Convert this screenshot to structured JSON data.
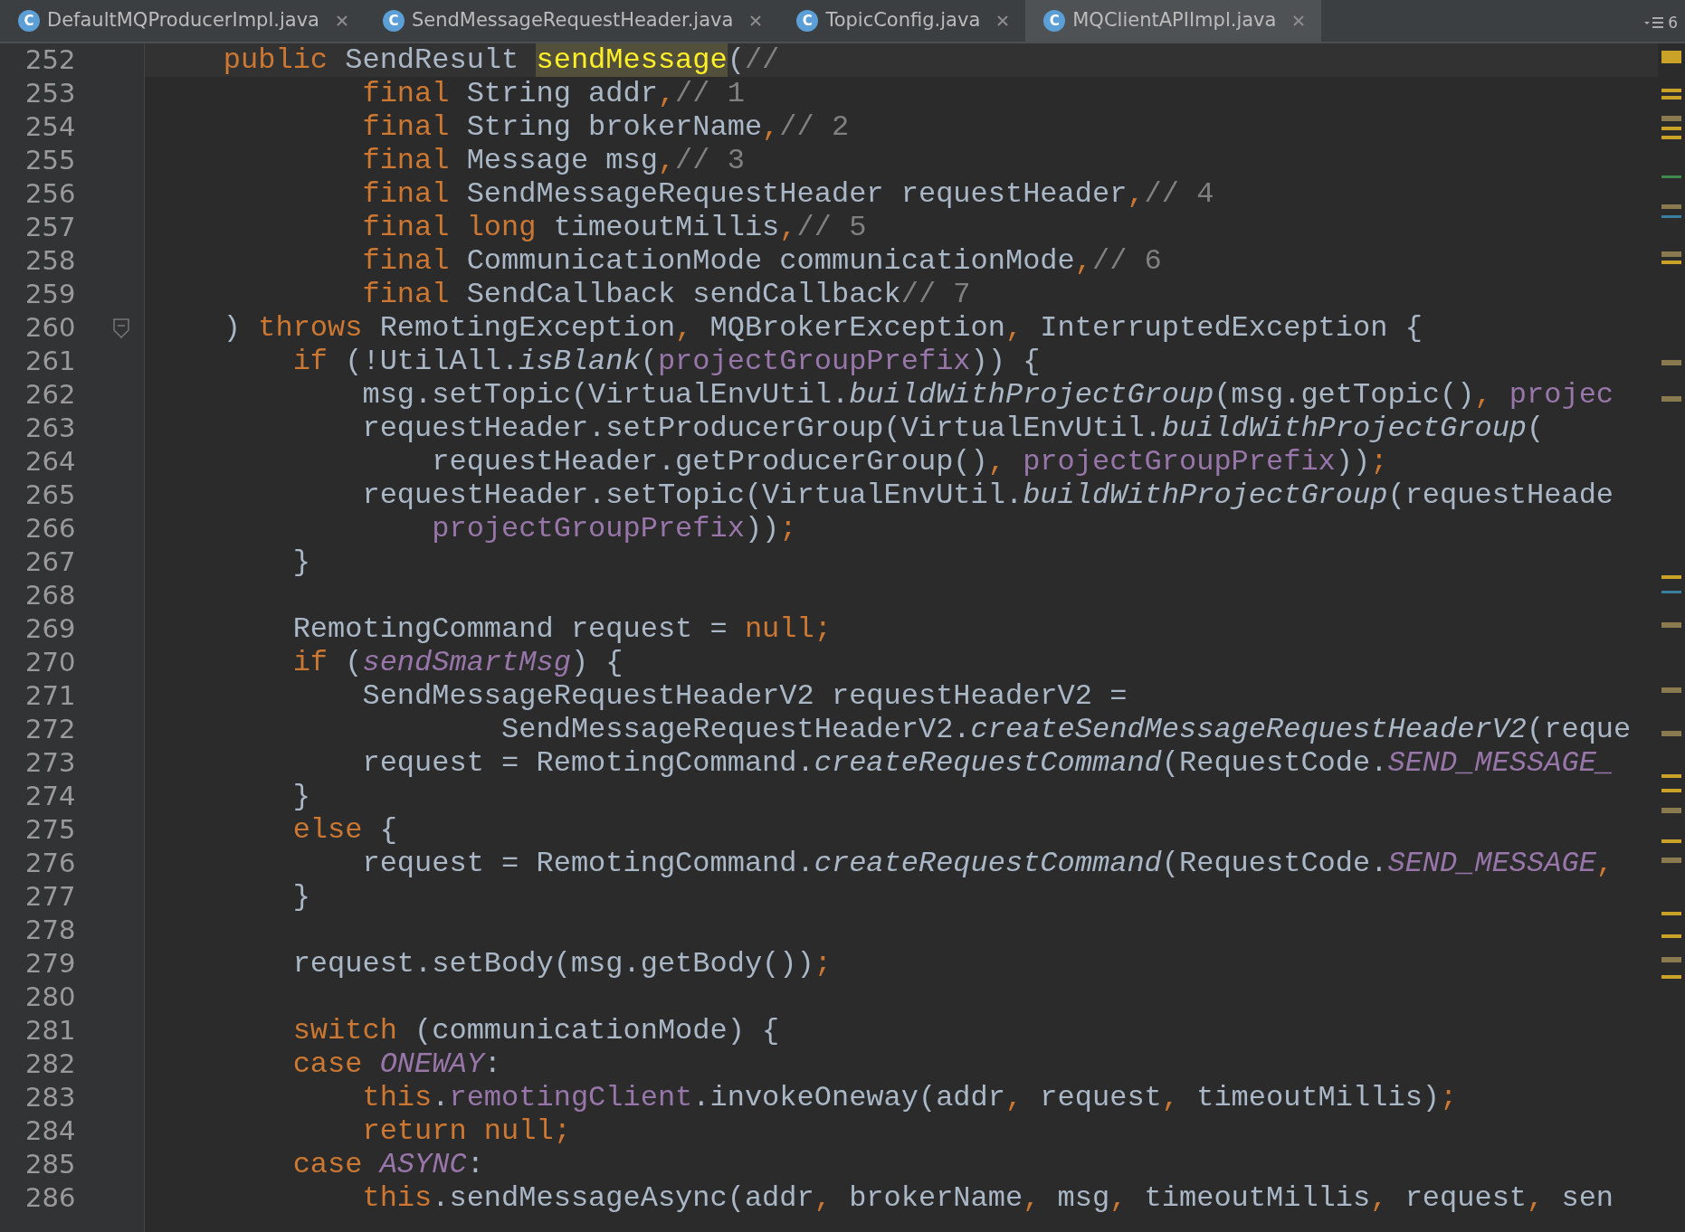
{
  "tabs": [
    {
      "badge": "C",
      "label": "DefaultMQProducerImpl.java",
      "selected": false
    },
    {
      "badge": "C",
      "label": "SendMessageRequestHeader.java",
      "selected": false
    },
    {
      "badge": "C",
      "label": "TopicConfig.java",
      "selected": false
    },
    {
      "badge": "C",
      "label": "MQClientAPIImpl.java",
      "selected": true
    }
  ],
  "tab_overflow_count": "6",
  "lines": [
    {
      "n": "252",
      "current": true,
      "tokens": [
        {
          "kind": "keyword",
          "t": "    public "
        },
        {
          "kind": "plain",
          "t": "SendResult "
        },
        {
          "kind": "highlight",
          "t": "sendMessage"
        },
        {
          "kind": "plain",
          "t": "("
        },
        {
          "kind": "comment",
          "t": "//"
        }
      ]
    },
    {
      "n": "253",
      "tokens": [
        {
          "kind": "keyword",
          "t": "            final "
        },
        {
          "kind": "plain",
          "t": "String addr"
        },
        {
          "kind": "keyword",
          "t": ","
        },
        {
          "kind": "comment",
          "t": "// 1"
        }
      ]
    },
    {
      "n": "254",
      "tokens": [
        {
          "kind": "keyword",
          "t": "            final "
        },
        {
          "kind": "plain",
          "t": "String brokerName"
        },
        {
          "kind": "keyword",
          "t": ","
        },
        {
          "kind": "comment",
          "t": "// 2"
        }
      ]
    },
    {
      "n": "255",
      "tokens": [
        {
          "kind": "keyword",
          "t": "            final "
        },
        {
          "kind": "plain",
          "t": "Message msg"
        },
        {
          "kind": "keyword",
          "t": ","
        },
        {
          "kind": "comment",
          "t": "// 3"
        }
      ]
    },
    {
      "n": "256",
      "tokens": [
        {
          "kind": "keyword",
          "t": "            final "
        },
        {
          "kind": "plain",
          "t": "SendMessageRequestHeader requestHeader"
        },
        {
          "kind": "keyword",
          "t": ","
        },
        {
          "kind": "comment",
          "t": "// 4"
        }
      ]
    },
    {
      "n": "257",
      "tokens": [
        {
          "kind": "keyword",
          "t": "            final long "
        },
        {
          "kind": "plain",
          "t": "timeoutMillis"
        },
        {
          "kind": "keyword",
          "t": ","
        },
        {
          "kind": "comment",
          "t": "// 5"
        }
      ]
    },
    {
      "n": "258",
      "tokens": [
        {
          "kind": "keyword",
          "t": "            final "
        },
        {
          "kind": "plain",
          "t": "CommunicationMode communicationMode"
        },
        {
          "kind": "keyword",
          "t": ","
        },
        {
          "kind": "comment",
          "t": "// 6"
        }
      ]
    },
    {
      "n": "259",
      "tokens": [
        {
          "kind": "keyword",
          "t": "            final "
        },
        {
          "kind": "plain",
          "t": "SendCallback sendCallback"
        },
        {
          "kind": "comment",
          "t": "// 7"
        }
      ]
    },
    {
      "n": "260",
      "fold_marker": true,
      "tokens": [
        {
          "kind": "plain",
          "t": "    ) "
        },
        {
          "kind": "keyword",
          "t": "throws "
        },
        {
          "kind": "plain",
          "t": "RemotingException"
        },
        {
          "kind": "keyword",
          "t": ", "
        },
        {
          "kind": "plain",
          "t": "MQBrokerException"
        },
        {
          "kind": "keyword",
          "t": ", "
        },
        {
          "kind": "plain",
          "t": "InterruptedException {"
        }
      ]
    },
    {
      "n": "261",
      "tokens": [
        {
          "kind": "keyword",
          "t": "        if "
        },
        {
          "kind": "plain",
          "t": "(!UtilAll."
        },
        {
          "kind": "italic",
          "t": "isBlank"
        },
        {
          "kind": "plain",
          "t": "("
        },
        {
          "kind": "field",
          "t": "projectGroupPrefix"
        },
        {
          "kind": "plain",
          "t": ")) {"
        }
      ]
    },
    {
      "n": "262",
      "tokens": [
        {
          "kind": "plain",
          "t": "            msg.setTopic(VirtualEnvUtil."
        },
        {
          "kind": "italic",
          "t": "buildWithProjectGroup"
        },
        {
          "kind": "plain",
          "t": "(msg.getTopic()"
        },
        {
          "kind": "keyword",
          "t": ", "
        },
        {
          "kind": "field",
          "t": "projec"
        }
      ]
    },
    {
      "n": "263",
      "tokens": [
        {
          "kind": "plain",
          "t": "            requestHeader.setProducerGroup(VirtualEnvUtil."
        },
        {
          "kind": "italic",
          "t": "buildWithProjectGroup"
        },
        {
          "kind": "plain",
          "t": "("
        }
      ]
    },
    {
      "n": "264",
      "tokens": [
        {
          "kind": "plain",
          "t": "                requestHeader.getProducerGroup()"
        },
        {
          "kind": "keyword",
          "t": ", "
        },
        {
          "kind": "field",
          "t": "projectGroupPrefix"
        },
        {
          "kind": "plain",
          "t": "))"
        },
        {
          "kind": "keyword",
          "t": ";"
        }
      ]
    },
    {
      "n": "265",
      "tokens": [
        {
          "kind": "plain",
          "t": "            requestHeader.setTopic(VirtualEnvUtil."
        },
        {
          "kind": "italic",
          "t": "buildWithProjectGroup"
        },
        {
          "kind": "plain",
          "t": "(requestHeade"
        }
      ]
    },
    {
      "n": "266",
      "tokens": [
        {
          "kind": "field",
          "t": "                projectGroupPrefix"
        },
        {
          "kind": "plain",
          "t": "))"
        },
        {
          "kind": "keyword",
          "t": ";"
        }
      ]
    },
    {
      "n": "267",
      "tokens": [
        {
          "kind": "plain",
          "t": "        }"
        }
      ]
    },
    {
      "n": "268"
    },
    {
      "n": "269",
      "tokens": [
        {
          "kind": "plain",
          "t": "        RemotingCommand request = "
        },
        {
          "kind": "keyword",
          "t": "null;"
        }
      ]
    },
    {
      "n": "270",
      "tokens": [
        {
          "kind": "keyword",
          "t": "        if "
        },
        {
          "kind": "plain",
          "t": "("
        },
        {
          "kind": "static",
          "t": "sendSmartMsg"
        },
        {
          "kind": "plain",
          "t": ") {"
        }
      ]
    },
    {
      "n": "271",
      "tokens": [
        {
          "kind": "plain",
          "t": "            SendMessageRequestHeaderV2 requestHeaderV2 ="
        }
      ]
    },
    {
      "n": "272",
      "tokens": [
        {
          "kind": "plain",
          "t": "                    SendMessageRequestHeaderV2."
        },
        {
          "kind": "italic",
          "t": "createSendMessageRequestHeaderV2"
        },
        {
          "kind": "plain",
          "t": "(reque"
        }
      ]
    },
    {
      "n": "273",
      "tokens": [
        {
          "kind": "plain",
          "t": "            request = RemotingCommand."
        },
        {
          "kind": "italic",
          "t": "createRequestCommand"
        },
        {
          "kind": "plain",
          "t": "(RequestCode."
        },
        {
          "kind": "static",
          "t": "SEND_MESSAGE_"
        }
      ]
    },
    {
      "n": "274",
      "tokens": [
        {
          "kind": "plain",
          "t": "        }"
        }
      ]
    },
    {
      "n": "275",
      "tokens": [
        {
          "kind": "keyword",
          "t": "        else "
        },
        {
          "kind": "plain",
          "t": "{"
        }
      ]
    },
    {
      "n": "276",
      "tokens": [
        {
          "kind": "plain",
          "t": "            request = RemotingCommand."
        },
        {
          "kind": "italic",
          "t": "createRequestCommand"
        },
        {
          "kind": "plain",
          "t": "(RequestCode."
        },
        {
          "kind": "static",
          "t": "SEND_MESSAGE"
        },
        {
          "kind": "keyword",
          "t": ","
        }
      ]
    },
    {
      "n": "277",
      "tokens": [
        {
          "kind": "plain",
          "t": "        }"
        }
      ]
    },
    {
      "n": "278"
    },
    {
      "n": "279",
      "tokens": [
        {
          "kind": "plain",
          "t": "        request.setBody(msg.getBody())"
        },
        {
          "kind": "keyword",
          "t": ";"
        }
      ]
    },
    {
      "n": "280"
    },
    {
      "n": "281",
      "tokens": [
        {
          "kind": "keyword",
          "t": "        switch "
        },
        {
          "kind": "plain",
          "t": "(communicationMode) {"
        }
      ]
    },
    {
      "n": "282",
      "tokens": [
        {
          "kind": "keyword",
          "t": "        case "
        },
        {
          "kind": "static",
          "t": "ONEWAY"
        },
        {
          "kind": "plain",
          "t": ":"
        }
      ]
    },
    {
      "n": "283",
      "tokens": [
        {
          "kind": "keyword",
          "t": "            this"
        },
        {
          "kind": "plain",
          "t": "."
        },
        {
          "kind": "field",
          "t": "remotingClient"
        },
        {
          "kind": "plain",
          "t": ".invokeOneway(addr"
        },
        {
          "kind": "keyword",
          "t": ", "
        },
        {
          "kind": "plain",
          "t": "request"
        },
        {
          "kind": "keyword",
          "t": ", "
        },
        {
          "kind": "plain",
          "t": "timeoutMillis)"
        },
        {
          "kind": "keyword",
          "t": ";"
        }
      ]
    },
    {
      "n": "284",
      "tokens": [
        {
          "kind": "keyword",
          "t": "            return null;"
        }
      ]
    },
    {
      "n": "285",
      "tokens": [
        {
          "kind": "keyword",
          "t": "        case "
        },
        {
          "kind": "static",
          "t": "ASYNC"
        },
        {
          "kind": "plain",
          "t": ":"
        }
      ]
    },
    {
      "n": "286",
      "tokens": [
        {
          "kind": "keyword",
          "t": "            this"
        },
        {
          "kind": "plain",
          "t": ".sendMessageAsync(addr"
        },
        {
          "kind": "keyword",
          "t": ", "
        },
        {
          "kind": "plain",
          "t": "brokerName"
        },
        {
          "kind": "keyword",
          "t": ", "
        },
        {
          "kind": "plain",
          "t": "msg"
        },
        {
          "kind": "keyword",
          "t": ", "
        },
        {
          "kind": "plain",
          "t": "timeoutMillis"
        },
        {
          "kind": "keyword",
          "t": ", "
        },
        {
          "kind": "plain",
          "t": "request"
        },
        {
          "kind": "keyword",
          "t": ", "
        },
        {
          "kind": "plain",
          "t": "sen"
        }
      ]
    }
  ]
}
